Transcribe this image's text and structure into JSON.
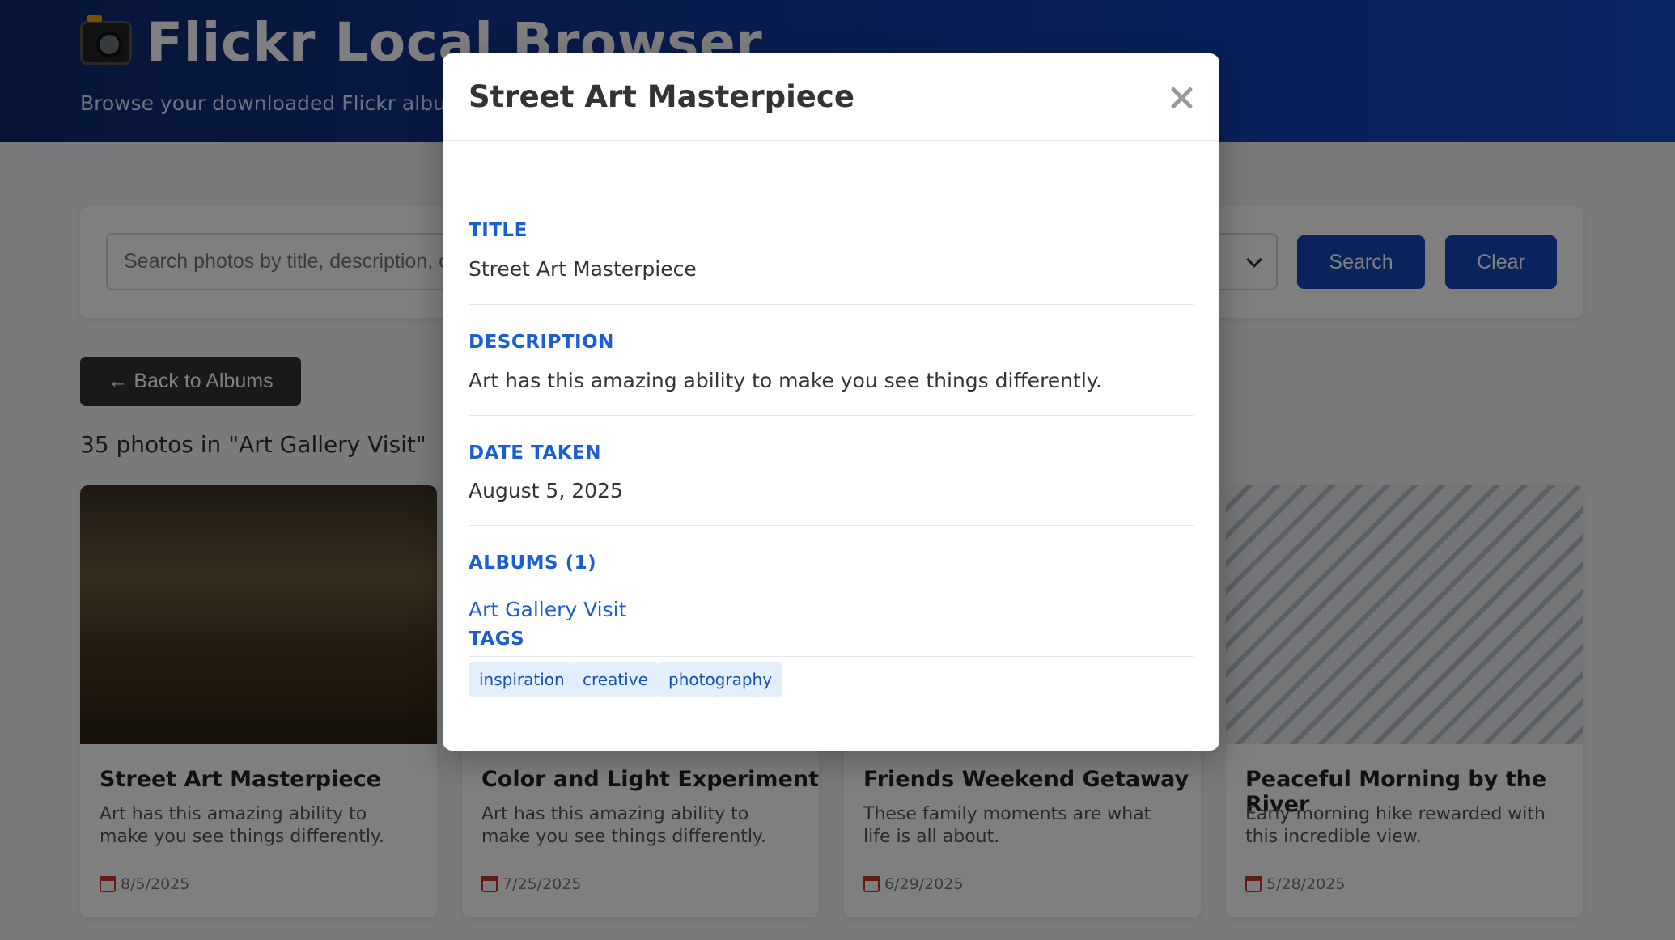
{
  "header": {
    "title": "Flickr Local Browser",
    "subtitle": "Browse your downloaded Flickr albums"
  },
  "search": {
    "placeholder": "Search photos by title, description, or tags...",
    "search_label": "Search",
    "clear_label": "Clear"
  },
  "nav": {
    "back_label": "← Back to Albums"
  },
  "gallery": {
    "count_text": "35 photos in \"Art Gallery Visit\"",
    "cards": [
      {
        "title": "Street Art Masterpiece",
        "description": "Art has this amazing ability to make you see things differently.",
        "date": "8/5/2025"
      },
      {
        "title": "Color and Light Experiment",
        "description": "Art has this amazing ability to make you see things differently.",
        "date": "7/25/2025"
      },
      {
        "title": "Friends Weekend Getaway",
        "description": "These family moments are what life is all about.",
        "date": "6/29/2025"
      },
      {
        "title": "Peaceful Morning by the River",
        "description": "Early morning hike rewarded with this incredible view.",
        "date": "5/28/2025"
      }
    ]
  },
  "modal": {
    "title": "Street Art Masterpiece",
    "sections": {
      "title_label": "TITLE",
      "title_value": "Street Art Masterpiece",
      "description_label": "DESCRIPTION",
      "description_value": "Art has this amazing ability to make you see things differently.",
      "date_label": "DATE TAKEN",
      "date_value": "August 5, 2025",
      "albums_label": "ALBUMS (1)",
      "albums": [
        "Art Gallery Visit"
      ],
      "tags_label": "TAGS",
      "tags": [
        "inspiration",
        "creative",
        "photography"
      ]
    }
  },
  "colors": {
    "header_bg": "#113a9e",
    "primary": "#1546b8",
    "accent_label": "#1a5fd1",
    "tag_bg": "#e3effd"
  }
}
